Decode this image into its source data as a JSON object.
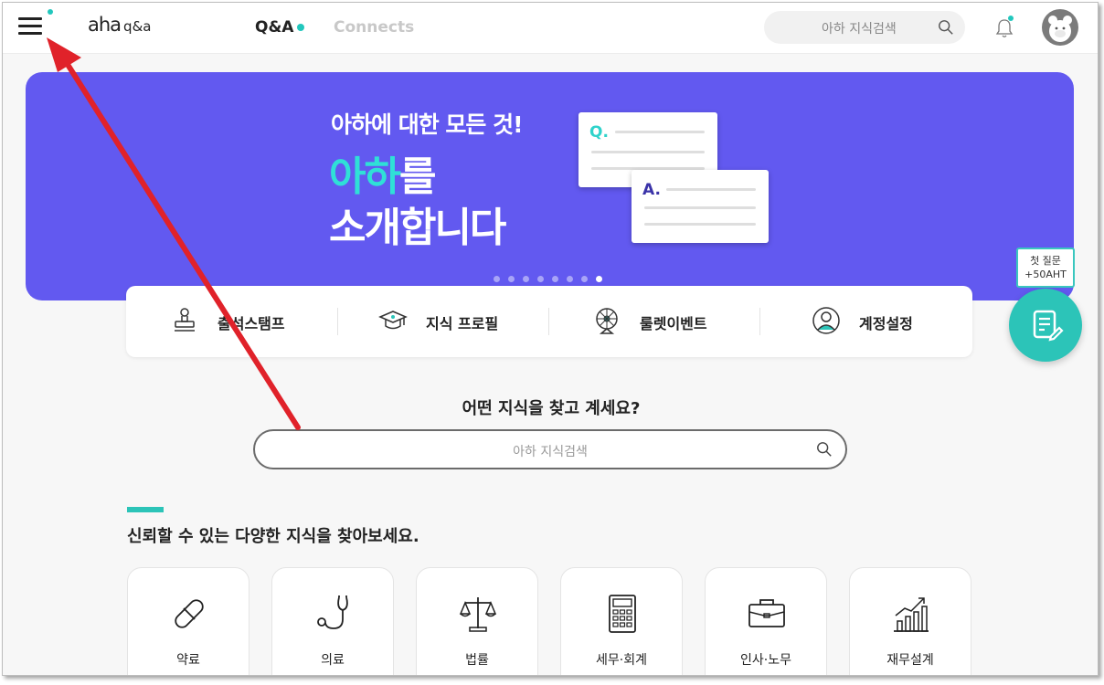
{
  "header": {
    "logo_main": "aha",
    "logo_sub": "q&a",
    "nav": [
      {
        "label": "Q&A",
        "active": true
      },
      {
        "label": "Connects",
        "active": false
      }
    ],
    "search_placeholder": "아하 지식검색",
    "accent_color": "#22c7bd"
  },
  "banner": {
    "line1": "아하에 대한 모든 것!",
    "line2_highlight": "아하",
    "line2_rest": "를",
    "line3": "소개합니다",
    "card_q": "Q.",
    "card_a": "A.",
    "background": "#6259f0",
    "slide_count": 8,
    "active_slide": 8
  },
  "quick_menu": [
    {
      "label": "출석스탬프",
      "icon": "stamp-icon"
    },
    {
      "label": "지식 프로필",
      "icon": "graduation-cap-icon"
    },
    {
      "label": "룰렛이벤트",
      "icon": "roulette-icon"
    },
    {
      "label": "계정설정",
      "icon": "user-circle-icon"
    }
  ],
  "fab": {
    "tooltip_line1": "첫 질문",
    "tooltip_line2": "+50AHT",
    "icon": "write-question-icon"
  },
  "search_section": {
    "question": "어떤 지식을 찾고 계세요?",
    "placeholder": "아하 지식검색"
  },
  "categories_section": {
    "title": "신뢰할 수 있는 다양한 지식을 찾아보세요.",
    "items": [
      {
        "label": "약료",
        "icon": "pill-icon"
      },
      {
        "label": "의료",
        "icon": "stethoscope-icon"
      },
      {
        "label": "법률",
        "icon": "scales-icon"
      },
      {
        "label": "세무·회계",
        "icon": "calculator-icon"
      },
      {
        "label": "인사·노무",
        "icon": "briefcase-icon"
      },
      {
        "label": "재무설계",
        "icon": "growth-chart-icon"
      }
    ]
  }
}
